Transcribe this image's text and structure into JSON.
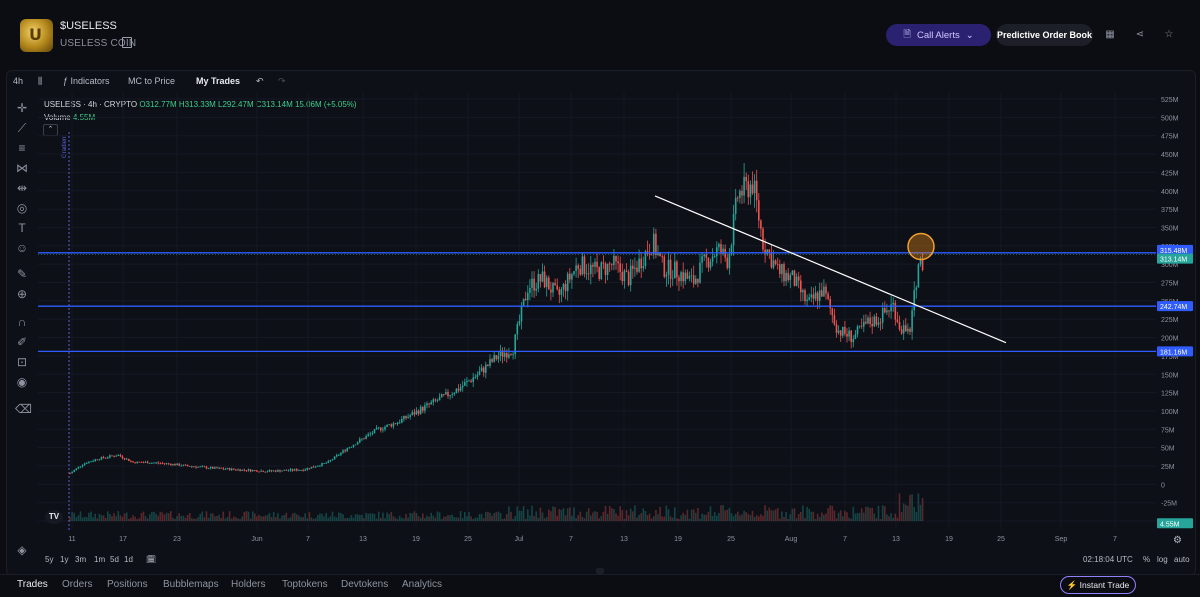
{
  "header": {
    "ticker": "$USELESS",
    "coin_name": "USELESS COIN",
    "call_alerts_label": "Call Alerts",
    "predictive_label": "Predictive Order Book"
  },
  "toolbar": {
    "interval": "4h",
    "indicators_label": "Indicators",
    "mc_label": "MC to Price",
    "trades_label": "My Trades"
  },
  "legend": {
    "symbol": "USELESS · 4h · CRYPTO",
    "ohlc": "O312.77M H313.33M L292.47M C313.14M 15.06M (+5.05%)",
    "volume_label": "Volume",
    "volume_value": "4.55M",
    "gradient_label": "Gradient"
  },
  "price_axis": [
    "525M",
    "500M",
    "475M",
    "450M",
    "425M",
    "400M",
    "375M",
    "350M",
    "325M",
    "300M",
    "275M",
    "250M",
    "225M",
    "200M",
    "175M",
    "150M",
    "125M",
    "100M",
    "75M",
    "50M",
    "25M",
    "0",
    "-25M",
    "-50M"
  ],
  "price_tags": {
    "line_top": "315.48M",
    "current": "313.14M",
    "mid": "242.74M",
    "low": "181.16M",
    "volume": "4.55M"
  },
  "time_axis": [
    "11",
    "17",
    "23",
    "Jun",
    "7",
    "13",
    "19",
    "25",
    "Jul",
    "7",
    "13",
    "19",
    "25",
    "Aug",
    "7",
    "13",
    "19",
    "25",
    "Sep",
    "7"
  ],
  "periods": [
    "5y",
    "1y",
    "3m",
    "1m",
    "5d",
    "1d"
  ],
  "clock": "02:18:04 UTC",
  "scale_options": [
    "%",
    "log",
    "auto"
  ],
  "bottom_tabs": [
    "Trades",
    "Orders",
    "Positions",
    "Bubblemaps",
    "Holders",
    "Toptokens",
    "Devtokens",
    "Analytics"
  ],
  "instant_trade_label": "Instant Trade",
  "colors": {
    "up": "#26a69a",
    "down": "#ef5350",
    "levels": "#2f5bff",
    "accent": "#8f82ff"
  },
  "icons": [
    "copy-icon",
    "bell-icon",
    "chevron-down-icon",
    "chart-grid-icon",
    "share-icon",
    "star-icon",
    "crosshair-icon",
    "trendline-icon",
    "fib-icon",
    "pattern-icon",
    "measure-icon",
    "circle-icon",
    "text-icon",
    "emoji-icon",
    "ruler-icon",
    "zoom-icon",
    "magnet-icon",
    "lock-icon",
    "eye-icon",
    "trash-icon",
    "layers-icon",
    "calendar-icon",
    "settings-icon",
    "undo-icon",
    "redo-icon"
  ]
}
